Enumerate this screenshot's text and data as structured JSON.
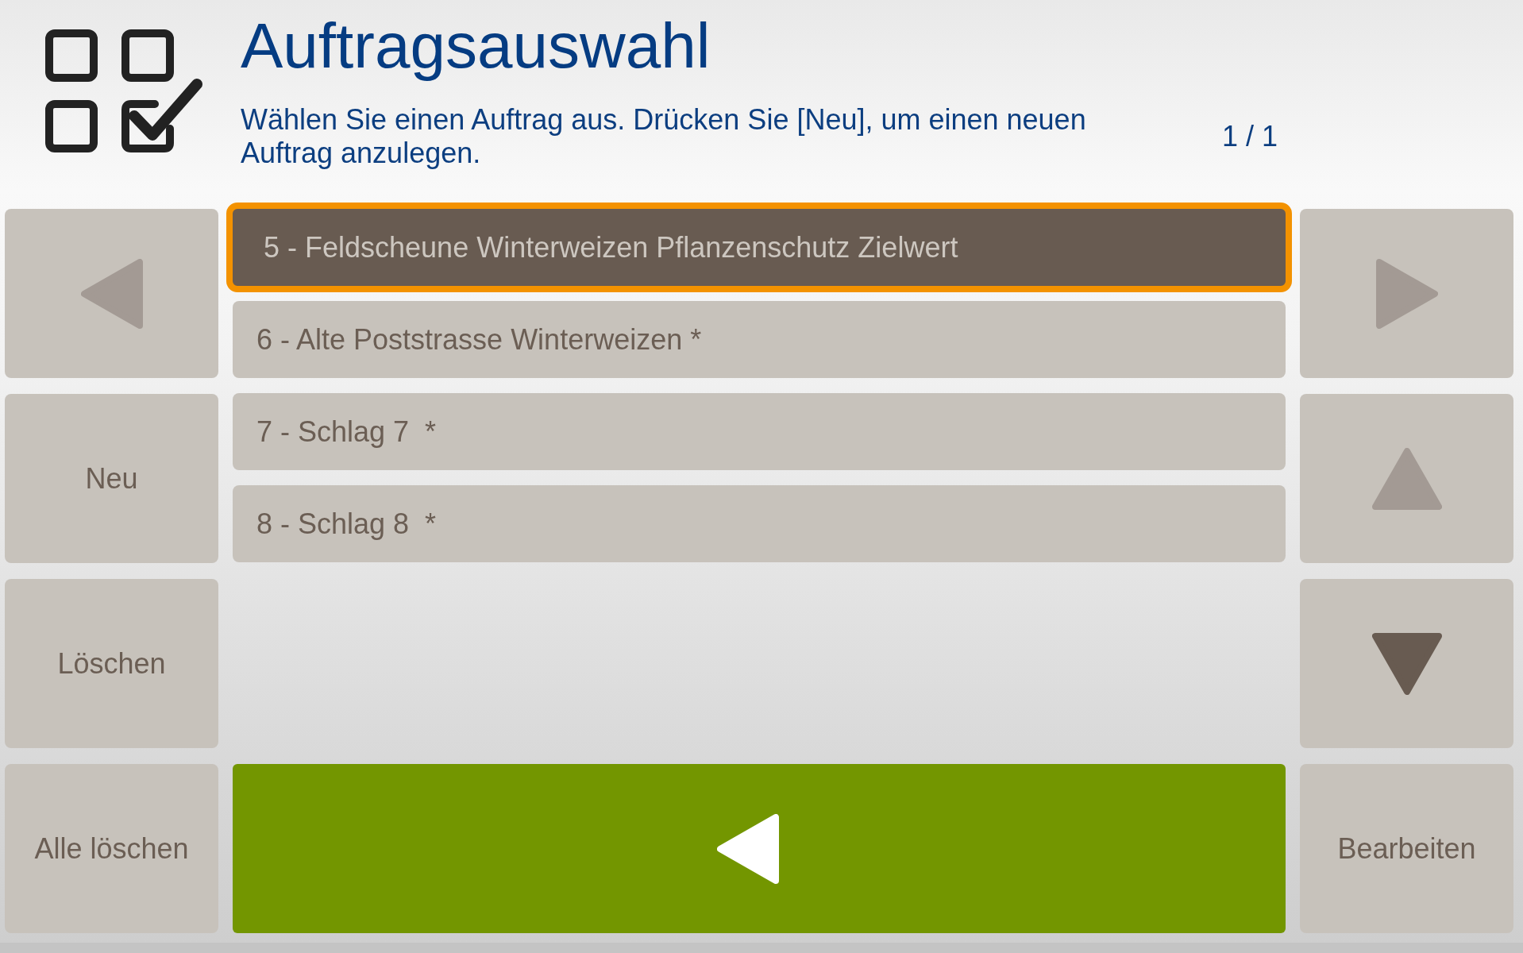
{
  "header": {
    "title": "Auftragsauswahl",
    "instruction": "Wählen Sie einen Auftrag aus. Drücken Sie [Neu], um einen neuen Auftrag anzulegen.",
    "page_indicator": "1 / 1"
  },
  "left_buttons": [
    {
      "kind": "prev",
      "disabled": true
    },
    {
      "kind": "text",
      "label": "Neu"
    },
    {
      "kind": "text",
      "label": "Löschen"
    },
    {
      "kind": "text",
      "label": "Alle löschen"
    }
  ],
  "orders": [
    {
      "label": "5 - Feldscheune Winterweizen Pflanzenschutz Zielwert",
      "selected": true
    },
    {
      "label": "6 - Alte Poststrasse Winterweizen *",
      "selected": false
    },
    {
      "label": "7 - Schlag 7  *",
      "selected": false
    },
    {
      "label": "8 - Schlag 8  *",
      "selected": false
    }
  ],
  "right_buttons": [
    {
      "kind": "next",
      "disabled": true
    },
    {
      "kind": "up",
      "disabled": true
    },
    {
      "kind": "down",
      "disabled": false
    },
    {
      "kind": "text",
      "label": "Bearbeiten"
    }
  ]
}
